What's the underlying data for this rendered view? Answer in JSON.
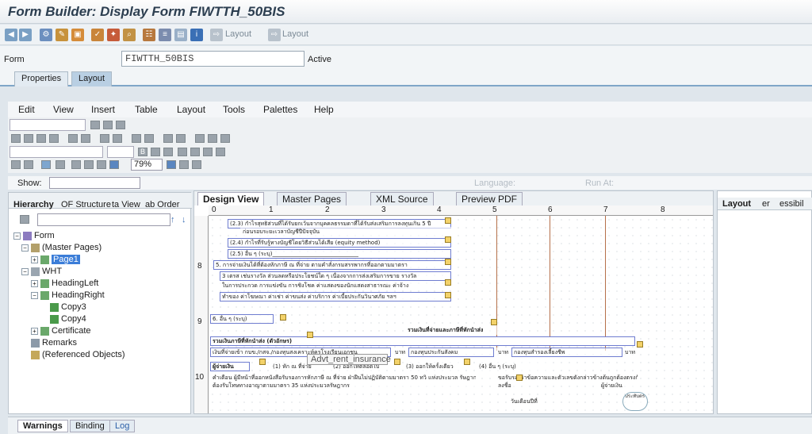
{
  "window": {
    "title": "Form Builder: Display Form FIWTTH_50BIS"
  },
  "app_toolbar": {
    "layout1": "Layout",
    "layout2": "Layout"
  },
  "form": {
    "label": "Form",
    "value": "FIWTTH_50BIS",
    "status": "Active"
  },
  "main_tabs": [
    "Properties",
    "Layout"
  ],
  "menu": [
    "Edit",
    "View",
    "Insert",
    "Table",
    "Layout",
    "Tools",
    "Palettes",
    "Help"
  ],
  "zoom": "79%",
  "show_row": {
    "label": "Show:",
    "language": "Language:",
    "run_at": "Run At:"
  },
  "left_panel": {
    "tabs": [
      "Hierarchy",
      "OF Structure",
      "ta View",
      "ab Order"
    ],
    "tree": [
      {
        "label": "Form",
        "level": 0
      },
      {
        "label": "(Master Pages)",
        "level": 1
      },
      {
        "label": "Page1",
        "level": 2
      },
      {
        "label": "WHT",
        "level": 1
      },
      {
        "label": "HeadingLeft",
        "level": 2
      },
      {
        "label": "HeadingRight",
        "level": 2
      },
      {
        "label": "Copy3",
        "level": 3
      },
      {
        "label": "Copy4",
        "level": 3
      },
      {
        "label": "Certificate",
        "level": 2
      },
      {
        "label": "Remarks",
        "level": 1
      },
      {
        "label": "(Referenced Objects)",
        "level": 1
      }
    ]
  },
  "center_tabs": [
    "Design View",
    "Master Pages",
    "XML Source",
    "Preview PDF"
  ],
  "ruler": [
    "0",
    "1",
    "2",
    "3",
    "4",
    "5",
    "6",
    "7",
    "8"
  ],
  "vruler": [
    "8",
    "9",
    "10"
  ],
  "canvas": {
    "lines": [
      "(2.3) กำไรสุทธิส่วนที่ได้รับยกเว้นจากบุคคลธรรมดาที่ได้รับส่งเสริมการลงทุนเกิน 5 ปี",
      "ก่อนรอบระยะเวลาบัญชีปีปัจจุบัน",
      "(2.4) กำไรที่รับรู้ทางบัญชีโดยวิธีส่วนได้เสีย (equity method)",
      "(2.5) อื่น ๆ (ระบุ)_______________________________",
      "5. การจ่ายเงินได้ที่ต้องหักภาษี ณ ที่จ่าย ตามคำสั่งกรมสรรพากรที่ออกตามมาตรา",
      "3 เตรส เช่นรางวัล ส่วนลดหรือประโยชน์ใด ๆ เนื่องจากการส่งเสริมการขาย รางวัล",
      "ในการประกวด การแข่งขัน การชิงโชค ค่าแสดงของนักแสดงสาธารณะ ค่าจ้าง",
      "ทำของ ค่าโฆษณา ค่าเช่า ค่าขนส่ง ค่าบริการ ค่าเบี้ยประกันวินาศภัย ฯลฯ",
      "6. อื่น ๆ (ระบุ)",
      "รวมเงินที่จ่ายและภาษีที่หักนำส่ง",
      "รวมเงินภาษีที่หักนำส่ง (ตัวอักษร)",
      "เงินที่จ่ายเข้า กบข./กสจ./กองทุนสงเคราะห์ครูโรงเรียนเอกชน",
      "บาท",
      "กองทุนประกันสังคม",
      "บาท",
      "กองทุนสำรองเลี้ยงชีพ",
      "บาท",
      "ผู้จ่ายเงิน",
      "(1) หัก ณ ที่จ่าย",
      "(2) ออกให้ตลอดไป",
      "(3) ออกให้ครั้งเดียว",
      "(4) อื่น ๆ (ระบุ)",
      "คำเตือน ผู้มีหน้าที่ออกหนังสือรับรองการหักภาษี ณ ที่จ่าย ฝ่าฝืนไม่ปฏิบัติตามมาตรา 50 ทวิ แห่งประมวล รัษฎากร",
      "ต้องรับโทษทางอาญาตามมาตรา 35 แห่งประมวลรัษฎากร",
      "ขอรับรองว่าข้อความและตัวเลขดังกล่าวข้างต้นถูกต้องตรงกับความจริงทุกประการ",
      "ลงชื่อ",
      "ผู้จ่ายเงิน",
      "ประทับตรา นิติบุคคล (ถ้ามี)",
      "วันเดือนปีที่"
    ],
    "tooltip": "Advt_rent_insurance"
  },
  "right_panel": {
    "tabs": [
      "Layout",
      "er",
      "essibil"
    ]
  },
  "bottom_tabs": [
    "Warnings",
    "Binding",
    "Log"
  ]
}
